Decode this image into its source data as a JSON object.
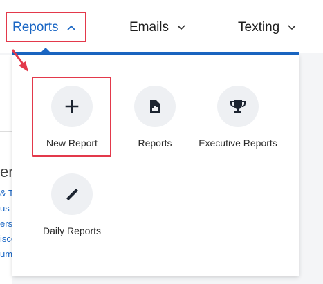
{
  "nav": {
    "reports_label": "Reports",
    "emails_label": "Emails",
    "texting_label": "Texting",
    "reports_chevron": "chevron-up-icon",
    "emails_chevron": "chevron-down-icon",
    "texting_chevron": "chevron-down-icon",
    "active_color": "#1a66c4"
  },
  "dropdown": {
    "items": [
      {
        "label": "New Report",
        "icon": "plus-icon"
      },
      {
        "label": "Reports",
        "icon": "report-file-icon"
      },
      {
        "label": "Executive Reports",
        "icon": "trophy-icon"
      },
      {
        "label": "Daily Reports",
        "icon": "ruler-pencil-icon"
      }
    ]
  },
  "annotation": {
    "highlight_color": "#e3394b"
  },
  "background_snippets": [
    "er",
    "& T",
    "us",
    "ers",
    "isco",
    "ume"
  ]
}
